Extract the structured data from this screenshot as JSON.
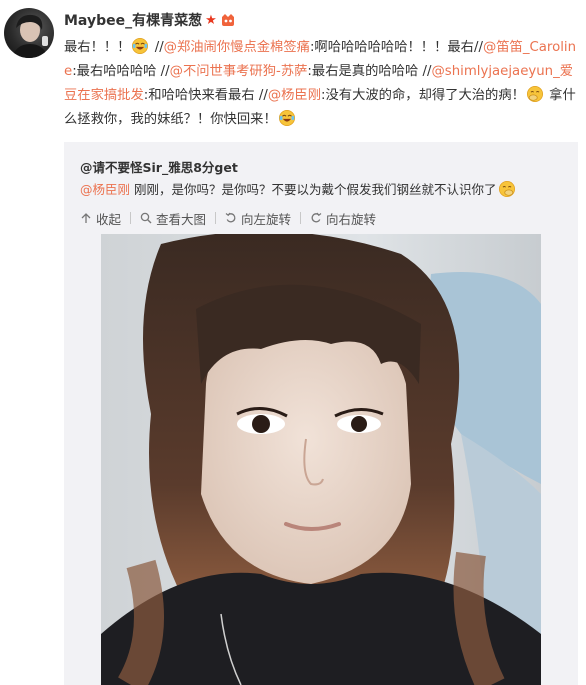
{
  "post": {
    "author": "Maybee_有棵青菜葱",
    "segments": [
      {
        "text": "最右！！！",
        "type": "text"
      },
      {
        "emoji": "laugh-tears"
      },
      {
        "text": " //",
        "type": "text"
      },
      {
        "text": "@郑油闹你慢点金棉签痛",
        "type": "mention"
      },
      {
        "text": ":啊哈哈哈哈哈哈！！！最右//",
        "type": "text"
      },
      {
        "text": "@笛笛_Caroline",
        "type": "mention"
      },
      {
        "text": ":最右哈哈哈哈 //",
        "type": "text"
      },
      {
        "text": "@不问世事考研狗-苏萨",
        "type": "mention"
      },
      {
        "text": ":最右是真的哈哈哈 //",
        "type": "text"
      },
      {
        "text": "@shimlyjaejaeyun_爱豆在家搞批发",
        "type": "mention"
      },
      {
        "text": ":和哈哈快来看最右 //",
        "type": "text"
      },
      {
        "text": "@杨臣刚",
        "type": "mention"
      },
      {
        "text": ":没有大波的命，却得了大治的病！",
        "type": "text"
      },
      {
        "emoji": "cover-mouth"
      },
      {
        "text": " 拿什么拯救你，我的妹纸？！你快回来！",
        "type": "text"
      },
      {
        "emoji": "laugh-tears"
      }
    ]
  },
  "repost": {
    "author": "@请不要怪Sir_雅思8分get",
    "mention": "@杨臣刚",
    "text": " 刚刚，是你吗？是你吗？不要以为戴个假发我们钢丝就不认识你了",
    "toolbar": {
      "collapse": "收起",
      "view_large": "查看大图",
      "rotate_left": "向左旋转",
      "rotate_right": "向右旋转"
    }
  },
  "colors": {
    "mention": "#eb7350",
    "repost_bg": "#f2f2f5",
    "star": "#e8381f"
  }
}
